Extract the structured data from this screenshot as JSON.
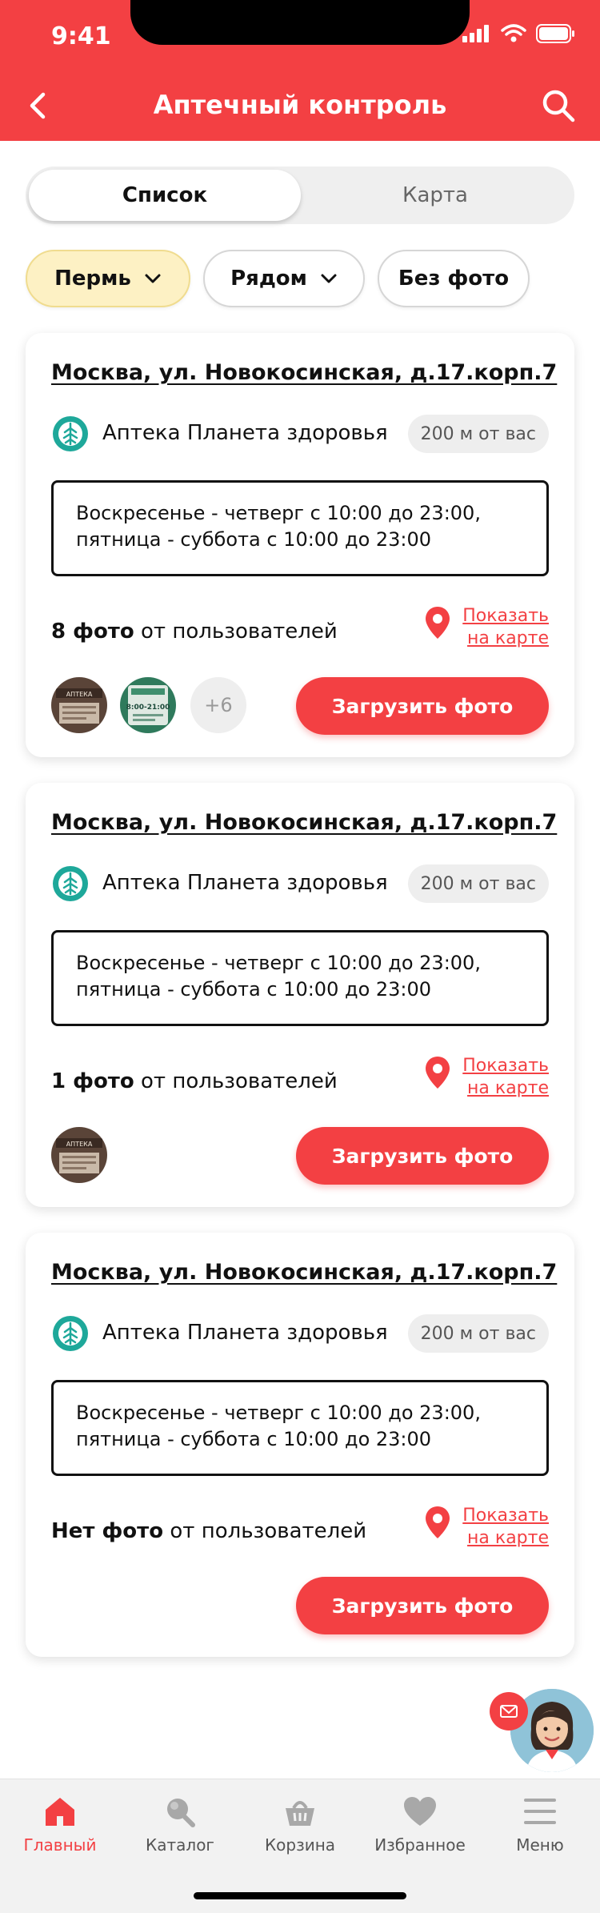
{
  "status_bar": {
    "time": "9:41"
  },
  "header": {
    "title": "Аптечный контроль"
  },
  "view_switch": {
    "list_label": "Список",
    "map_label": "Карта"
  },
  "filters": [
    {
      "label": "Пермь",
      "active": true,
      "dropdown": true
    },
    {
      "label": "Рядом",
      "active": false,
      "dropdown": true
    },
    {
      "label": "Без фото",
      "active": false,
      "dropdown": false
    }
  ],
  "cards": [
    {
      "address": "Москва, ул. Новокосинская, д.17.корп.7",
      "pharmacy": "Аптека Планета здоровья",
      "distance": "200 м от вас",
      "hours_line1": "Воскресенье - четверг с 10:00 до 23:00,",
      "hours_line2": "пятница - суббота с 10:00 до 23:00",
      "photos_count": "8 фото",
      "photos_suffix": " от пользователей",
      "map_link_line1": "Показать",
      "map_link_line2": "на карте",
      "more_photos": "+6",
      "upload_label": "Загрузить фото"
    },
    {
      "address": "Москва, ул. Новокосинская, д.17.корп.7",
      "pharmacy": "Аптека Планета здоровья",
      "distance": "200 м от вас",
      "hours_line1": "Воскресенье - четверг с 10:00 до 23:00,",
      "hours_line2": "пятница - суббота с 10:00 до 23:00",
      "photos_count": "1 фото",
      "photos_suffix": " от пользователей",
      "map_link_line1": "Показать",
      "map_link_line2": "на карте",
      "upload_label": "Загрузить фото"
    },
    {
      "address": "Москва, ул. Новокосинская, д.17.корп.7",
      "pharmacy": "Аптека Планета здоровья",
      "distance": "200 м от вас",
      "hours_line1": "Воскресенье - четверг с 10:00 до 23:00,",
      "hours_line2": "пятница - суббота с 10:00 до 23:00",
      "photos_count": "Нет фото",
      "photos_suffix": " от пользователей",
      "map_link_line1": "Показать",
      "map_link_line2": "на карте",
      "upload_label": "Загрузить фото"
    }
  ],
  "thumbnail_text": {
    "pharmacy_sign": "АПТЕКА",
    "hours_sign": "8:00-21:00"
  },
  "bottom_nav": [
    {
      "label": "Главный",
      "icon": "home-icon",
      "active": true
    },
    {
      "label": "Каталог",
      "icon": "catalog-search-icon",
      "active": false
    },
    {
      "label": "Корзина",
      "icon": "basket-icon",
      "active": false
    },
    {
      "label": "Избранное",
      "icon": "heart-icon",
      "active": false
    },
    {
      "label": "Меню",
      "icon": "menu-icon",
      "active": false
    }
  ],
  "colors": {
    "brand_red": "#f34043",
    "chip_active_bg": "#fdf1c4",
    "pharmacy_logo": "#1ea89a"
  }
}
